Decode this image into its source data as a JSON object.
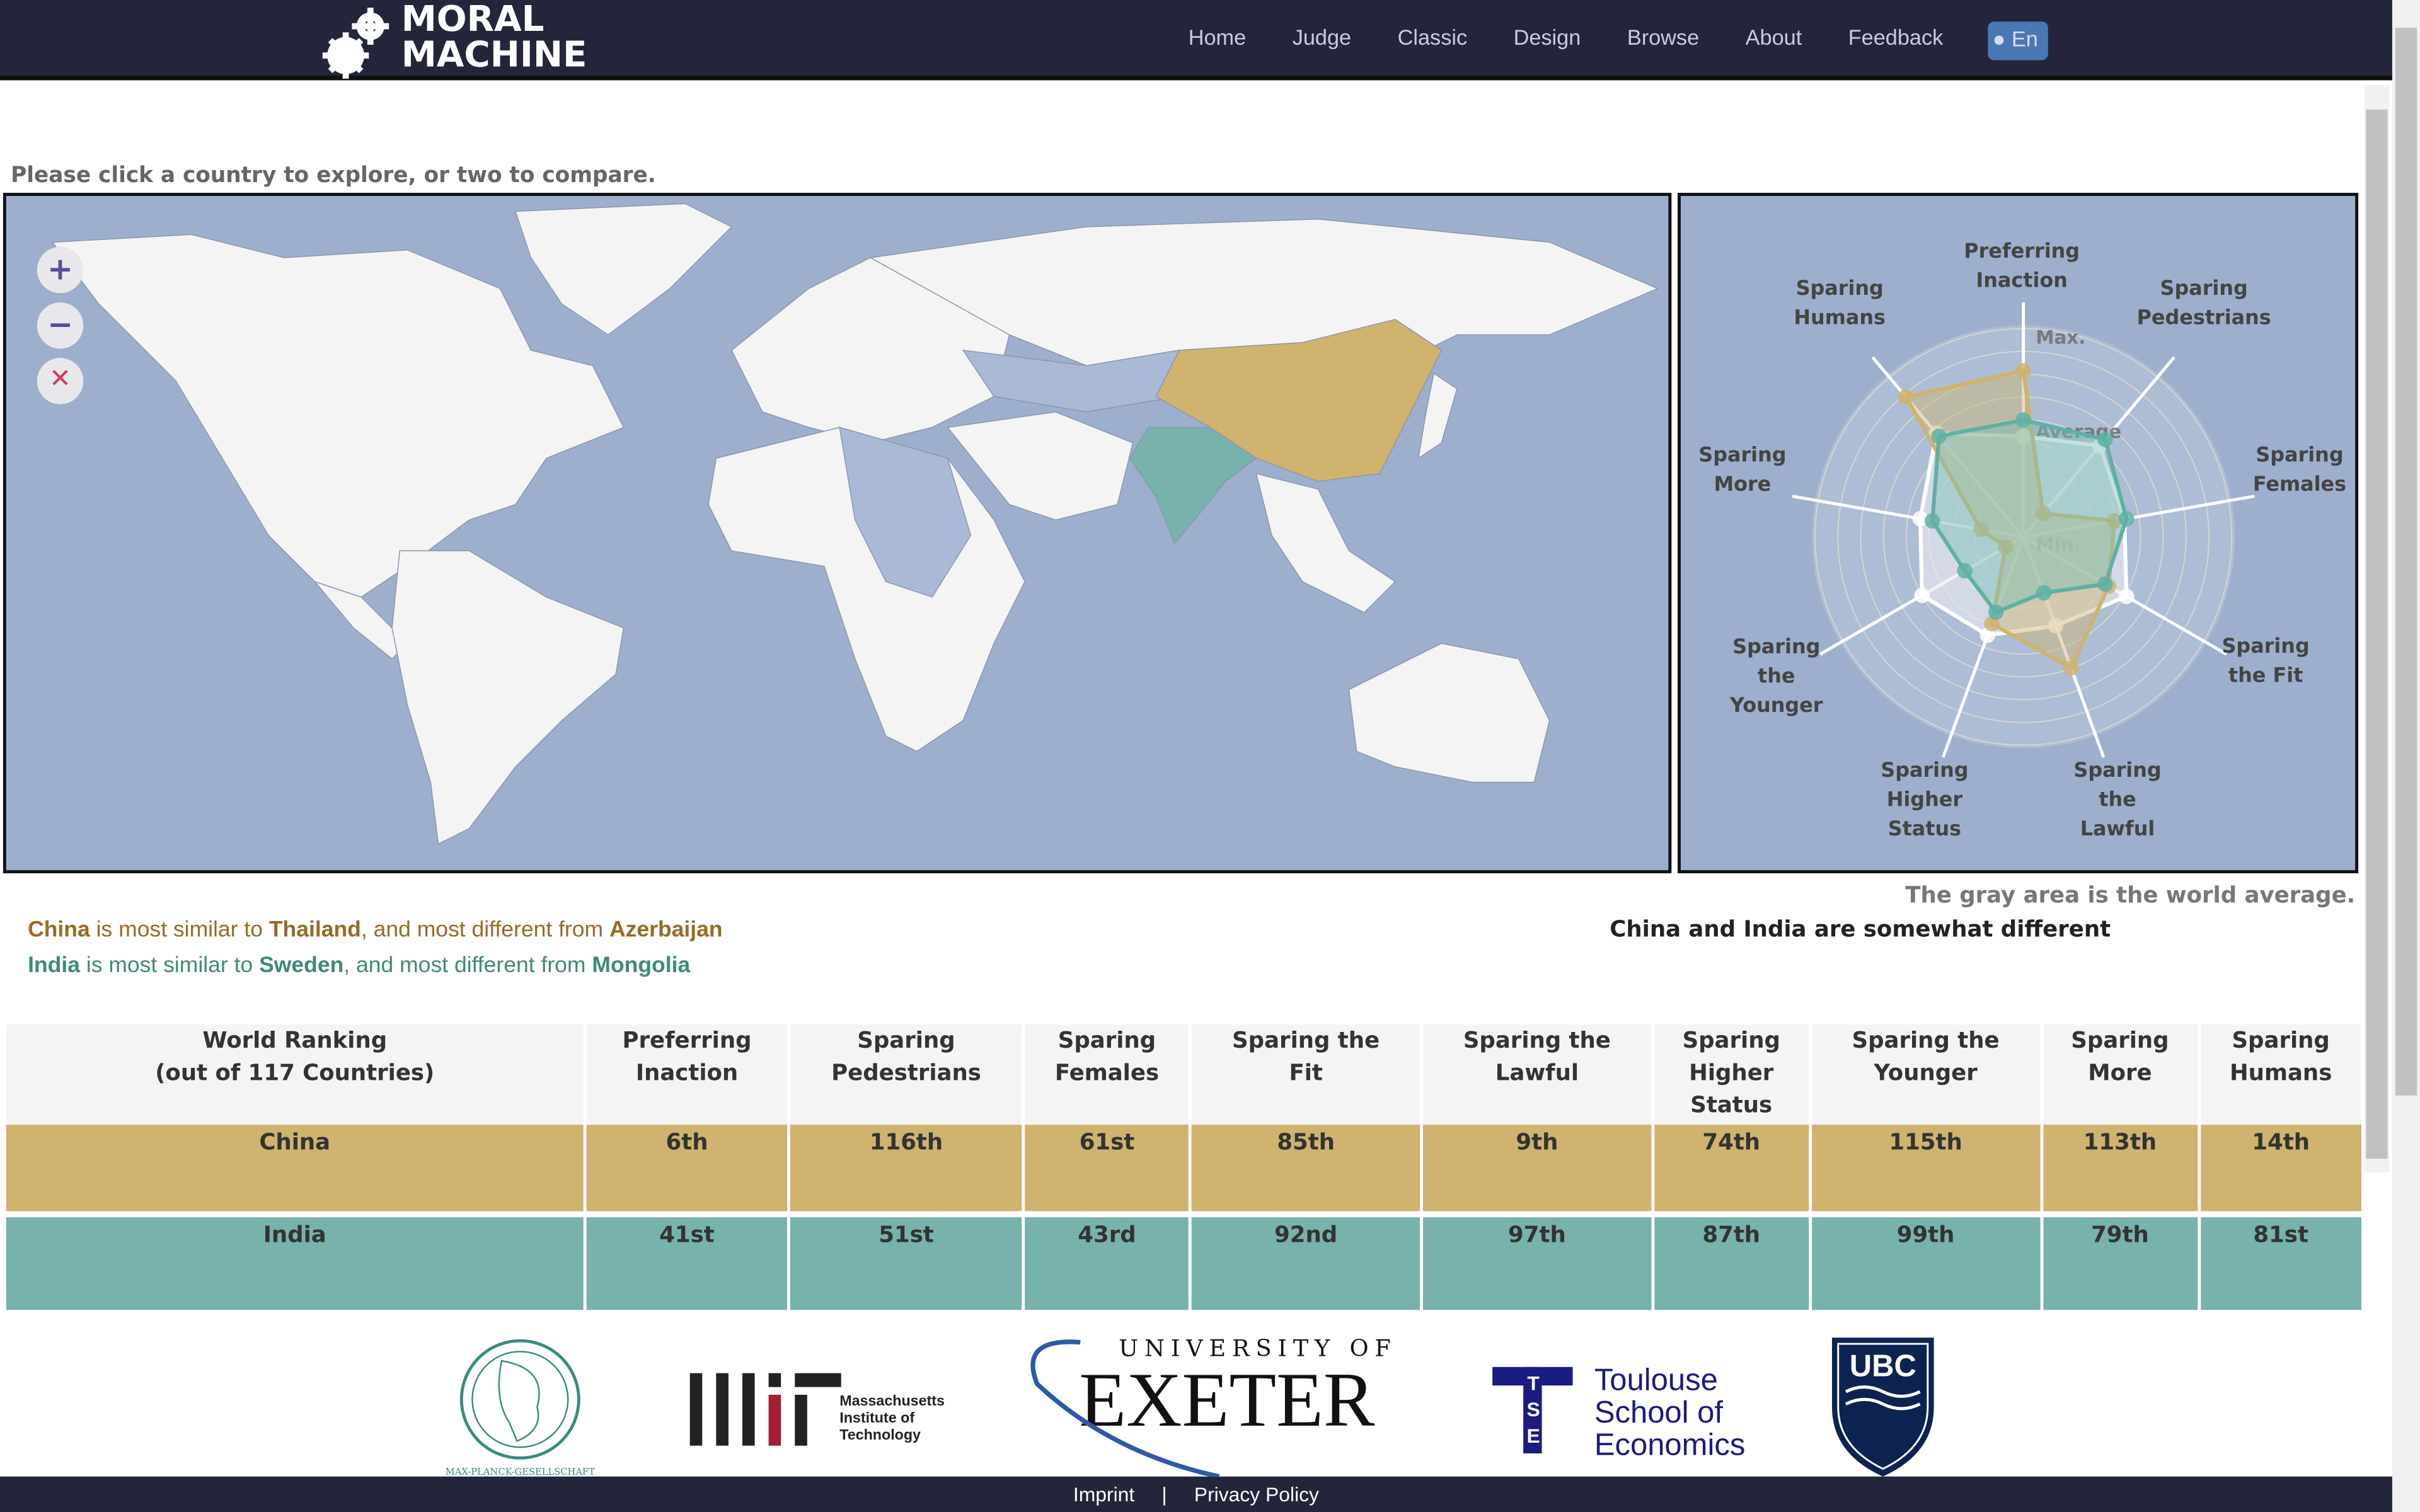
{
  "header": {
    "logo_line1": "MORAL",
    "logo_line2": "MACHINE",
    "nav": [
      "Home",
      "Judge",
      "Classic",
      "Design",
      "Browse",
      "About",
      "Feedback"
    ],
    "language": "En"
  },
  "prompt": "Please click a country to explore, or two to compare.",
  "map": {
    "zoom_in": "+",
    "zoom_out": "−",
    "reset": "✕",
    "selected": [
      {
        "country": "China",
        "color": "#cfb36e"
      },
      {
        "country": "India",
        "color": "#77b2ac"
      }
    ],
    "ocean_color": "#9dafcd"
  },
  "chart_data": {
    "type": "radar",
    "axes": [
      "Preferring\nInaction",
      "Sparing\nPedestrians",
      "Sparing\nFemales",
      "Sparing\nthe Fit",
      "Sparing\nthe\nLawful",
      "Sparing\nHigher\nStatus",
      "Sparing\nthe\nYounger",
      "Sparing\nMore",
      "Sparing\nHumans"
    ],
    "ring_labels": {
      "max": "Max.",
      "average": "Average",
      "min": "Min."
    },
    "scale": [
      0,
      1
    ],
    "series": [
      {
        "name": "World average",
        "color": "#ffffff",
        "values": [
          0.49,
          0.58,
          0.5,
          0.58,
          0.46,
          0.51,
          0.57,
          0.51,
          0.66
        ]
      },
      {
        "name": "China",
        "color": "#cfb36e",
        "values": [
          0.81,
          0.15,
          0.45,
          0.48,
          0.68,
          0.45,
          0.1,
          0.21,
          0.89
        ]
      },
      {
        "name": "India",
        "color": "#5fb0a5",
        "values": [
          0.57,
          0.62,
          0.51,
          0.46,
          0.29,
          0.39,
          0.33,
          0.45,
          0.64
        ]
      }
    ]
  },
  "radar_note": "The gray area is the world average.",
  "similarity": [
    {
      "country": "China",
      "t1": " is most similar to ",
      "similar": "Thailand",
      "t2": ", and most different from ",
      "different": "Azerbaijan",
      "color": "#9a6a24"
    },
    {
      "country": "India",
      "t1": " is most similar to ",
      "similar": "Sweden",
      "t2": ", and most different from ",
      "different": "Mongolia",
      "color": "#3e8a78"
    }
  ],
  "comparison": "China and India are somewhat different",
  "table": {
    "headers": [
      "World Ranking\n(out of 117 Countries)",
      "Preferring\nInaction",
      "Sparing\nPedestrians",
      "Sparing\nFemales",
      "Sparing the\nFit",
      "Sparing the\nLawful",
      "Sparing\nHigher\nStatus",
      "Sparing the\nYounger",
      "Sparing\nMore",
      "Sparing\nHumans"
    ],
    "rows": [
      [
        "China",
        "6th",
        "116th",
        "61st",
        "85th",
        "9th",
        "74th",
        "115th",
        "113th",
        "14th"
      ],
      [
        "India",
        "41st",
        "51st",
        "43rd",
        "92nd",
        "97th",
        "87th",
        "99th",
        "79th",
        "81st"
      ]
    ]
  },
  "partners": {
    "mpg": "MAX-PLANCK-GESELLSCHAFT",
    "mit": [
      "Massachusetts",
      "Institute of",
      "Technology"
    ],
    "exeter_top": "UNIVERSITY OF",
    "exeter": "EXETER",
    "tse": [
      "Toulouse",
      "School of",
      "Economics"
    ],
    "tse_mark": "TSE",
    "ubc": "UBC"
  },
  "footer": {
    "imprint": "Imprint",
    "sep": "|",
    "privacy": "Privacy Policy"
  }
}
